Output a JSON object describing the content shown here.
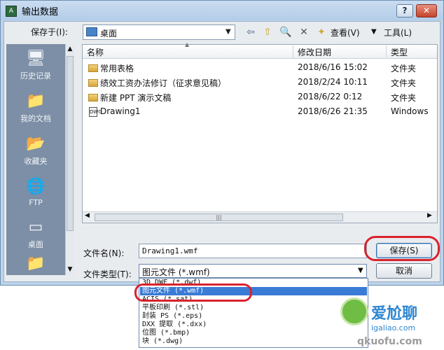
{
  "window": {
    "title": "输出数据",
    "help": "?",
    "close": "✕"
  },
  "toolbar": {
    "save_in_label": "保存于(I):",
    "location": "桌面",
    "view_label": "查看(V)",
    "tools_label": "工具(L)"
  },
  "places": [
    {
      "label": "历史记录",
      "icon": "history-icon"
    },
    {
      "label": "我的文档",
      "icon": "documents-icon"
    },
    {
      "label": "收藏夹",
      "icon": "favorites-icon"
    },
    {
      "label": "FTP",
      "icon": "ftp-icon"
    },
    {
      "label": "桌面",
      "icon": "desktop-icon"
    }
  ],
  "filelist": {
    "columns": [
      "名称",
      "修改日期",
      "类型"
    ],
    "rows": [
      {
        "name": "常用表格",
        "date": "2018/6/16 15:02",
        "type": "文件夹",
        "icon": "folder-icon"
      },
      {
        "name": "绩效工资办法修订（征求意见稿）",
        "date": "2018/2/24 10:11",
        "type": "文件夹",
        "icon": "folder-icon"
      },
      {
        "name": "新建 PPT 演示文稿",
        "date": "2018/6/22 0:12",
        "type": "文件夹",
        "icon": "folder-icon"
      },
      {
        "name": "Drawing1",
        "date": "2018/6/26 21:35",
        "type": "Windows",
        "icon": "dwg-file-icon"
      }
    ]
  },
  "form": {
    "filename_label": "文件名(N):",
    "filename_value": "Drawing1.wmf",
    "filetype_label": "文件类型(T):",
    "filetype_value": "图元文件 (*.wmf)",
    "save_button": "保存(S)",
    "cancel_button": "取消"
  },
  "filetype_options": [
    "3D DWF (*.dwf)",
    "图元文件 (*.wmf)",
    "ACIS (*.sat)",
    "平板印刷 (*.stl)",
    "封装 PS (*.eps)",
    "DXX 提取 (*.dxx)",
    "位图 (*.bmp)",
    "块 (*.dwg)"
  ],
  "selected_option_index": 1,
  "watermark": {
    "title": "爱尬聊",
    "url": "igaliao.com",
    "url2": "qkuofu.com"
  },
  "colors": {
    "highlight": "#d9232e",
    "selection": "#3a7bd5"
  }
}
